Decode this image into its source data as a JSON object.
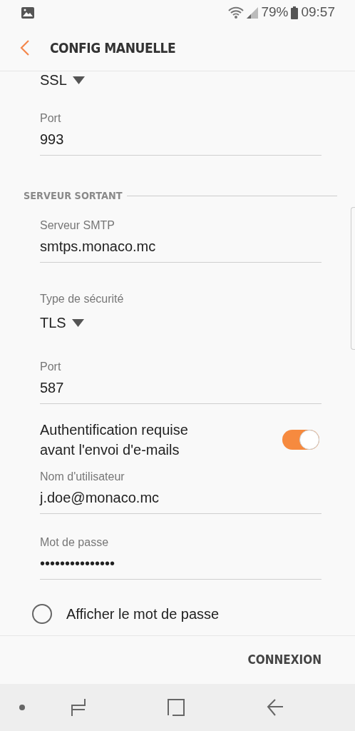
{
  "status_bar": {
    "battery": "79%",
    "time": "09:57"
  },
  "header": {
    "title": "CONFIG MANUELLE"
  },
  "items": [
    {
      "kind": "dropdown",
      "value": "SSL"
    },
    {
      "kind": "text",
      "label": "Port",
      "value": "993"
    },
    {
      "kind": "section",
      "label": "SERVEUR SORTANT"
    },
    {
      "kind": "text",
      "label": "Serveur SMTP",
      "value": "smtps.monaco.mc"
    },
    {
      "kind": "dropdown",
      "label": "Type de sécurité",
      "value": "TLS"
    },
    {
      "kind": "text",
      "label": "Port",
      "value": "587"
    },
    {
      "kind": "switch",
      "label": "Authentification requise avant l'envoi d'e-mails",
      "on": true
    },
    {
      "kind": "text",
      "label": "Nom d'utilisateur",
      "value": "j.doe@monaco.mc"
    },
    {
      "kind": "text",
      "label": "Mot de passe",
      "value": "•••••••••••••••"
    },
    {
      "kind": "radio",
      "label": "Afficher le mot de passe",
      "checked": false
    }
  ],
  "action": {
    "label": "CONNEXION"
  }
}
